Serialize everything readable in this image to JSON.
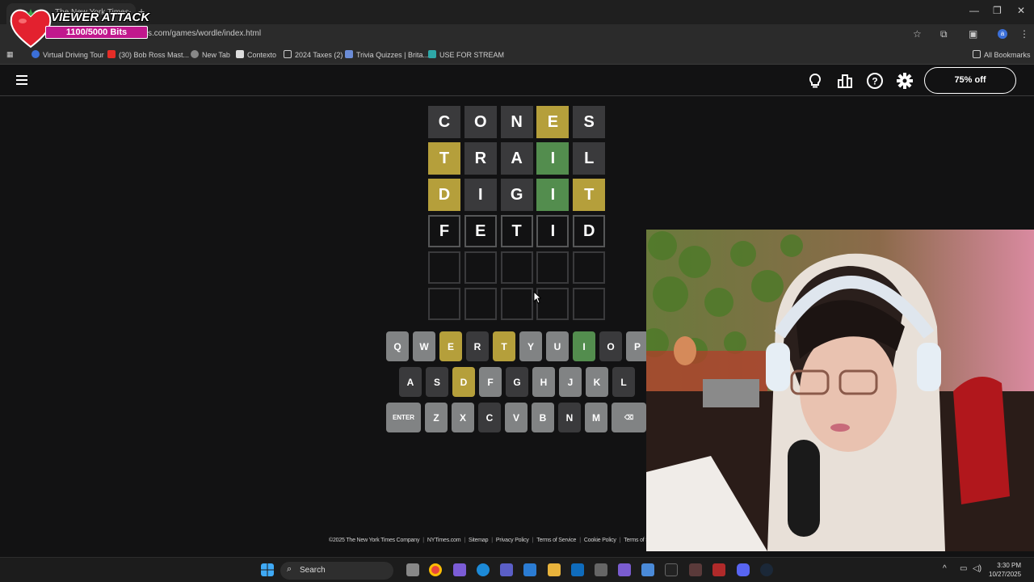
{
  "browser": {
    "tab_title": "The New York Times",
    "url": "s.com/games/wordle/index.html",
    "profile_initial": "a",
    "bookmarks": [
      {
        "label": "Virtual Driving Tour",
        "color": "#3b6fd8"
      },
      {
        "label": "(30) Bob Ross Mast...",
        "color": "#e52d27"
      },
      {
        "label": "New Tab",
        "color": "#888888"
      },
      {
        "label": "Contexto",
        "color": "#dddddd"
      },
      {
        "label": "2024 Taxes (2)",
        "color": "#cccccc"
      },
      {
        "label": "Trivia Quizzes | Brita...",
        "color": "#6b8cd6"
      },
      {
        "label": "USE FOR STREAM",
        "color": "#2ea7a7"
      }
    ],
    "all_bookmarks": "All Bookmarks"
  },
  "overlay": {
    "title": "VIEWER ATTACK",
    "bits": "1100/5000 Bits",
    "bits_progress": 0.22
  },
  "header": {
    "sale_label": "75% off"
  },
  "board": {
    "rows": [
      [
        {
          "l": "C",
          "s": "absent"
        },
        {
          "l": "O",
          "s": "absent"
        },
        {
          "l": "N",
          "s": "absent"
        },
        {
          "l": "E",
          "s": "present"
        },
        {
          "l": "S",
          "s": "absent"
        }
      ],
      [
        {
          "l": "T",
          "s": "present"
        },
        {
          "l": "R",
          "s": "absent"
        },
        {
          "l": "A",
          "s": "absent"
        },
        {
          "l": "I",
          "s": "correct"
        },
        {
          "l": "L",
          "s": "absent"
        }
      ],
      [
        {
          "l": "D",
          "s": "present"
        },
        {
          "l": "I",
          "s": "absent"
        },
        {
          "l": "G",
          "s": "absent"
        },
        {
          "l": "I",
          "s": "correct"
        },
        {
          "l": "T",
          "s": "present"
        }
      ],
      [
        {
          "l": "F",
          "s": "filled"
        },
        {
          "l": "E",
          "s": "filled"
        },
        {
          "l": "T",
          "s": "filled"
        },
        {
          "l": "I",
          "s": "filled"
        },
        {
          "l": "D",
          "s": "filled"
        }
      ],
      [
        {
          "l": "",
          "s": "empty"
        },
        {
          "l": "",
          "s": "empty"
        },
        {
          "l": "",
          "s": "empty"
        },
        {
          "l": "",
          "s": "empty"
        },
        {
          "l": "",
          "s": "empty"
        }
      ],
      [
        {
          "l": "",
          "s": "empty"
        },
        {
          "l": "",
          "s": "empty"
        },
        {
          "l": "",
          "s": "empty"
        },
        {
          "l": "",
          "s": "empty"
        },
        {
          "l": "",
          "s": "empty"
        }
      ]
    ]
  },
  "keyboard": {
    "rows": [
      [
        {
          "k": "Q",
          "s": ""
        },
        {
          "k": "W",
          "s": ""
        },
        {
          "k": "E",
          "s": "present"
        },
        {
          "k": "R",
          "s": "absent"
        },
        {
          "k": "T",
          "s": "present"
        },
        {
          "k": "Y",
          "s": ""
        },
        {
          "k": "U",
          "s": ""
        },
        {
          "k": "I",
          "s": "correct"
        },
        {
          "k": "O",
          "s": "absent"
        },
        {
          "k": "P",
          "s": ""
        }
      ],
      [
        {
          "k": "A",
          "s": "absent"
        },
        {
          "k": "S",
          "s": "absent"
        },
        {
          "k": "D",
          "s": "present"
        },
        {
          "k": "F",
          "s": ""
        },
        {
          "k": "G",
          "s": "absent"
        },
        {
          "k": "H",
          "s": ""
        },
        {
          "k": "J",
          "s": ""
        },
        {
          "k": "K",
          "s": ""
        },
        {
          "k": "L",
          "s": "absent"
        }
      ],
      [
        {
          "k": "ENTER",
          "s": "wide"
        },
        {
          "k": "Z",
          "s": ""
        },
        {
          "k": "X",
          "s": ""
        },
        {
          "k": "C",
          "s": "absent"
        },
        {
          "k": "V",
          "s": ""
        },
        {
          "k": "B",
          "s": ""
        },
        {
          "k": "N",
          "s": "absent"
        },
        {
          "k": "M",
          "s": ""
        },
        {
          "k": "⌫",
          "s": "wide"
        }
      ]
    ]
  },
  "footer": {
    "links": [
      "©2025 The New York Times Company",
      "NYTimes.com",
      "Sitemap",
      "Privacy Policy",
      "Terms of Service",
      "Cookie Policy",
      "Terms of Sale"
    ]
  },
  "taskbar": {
    "search_label": "Search",
    "time": "3:30 PM",
    "date": "10/27/2025"
  }
}
